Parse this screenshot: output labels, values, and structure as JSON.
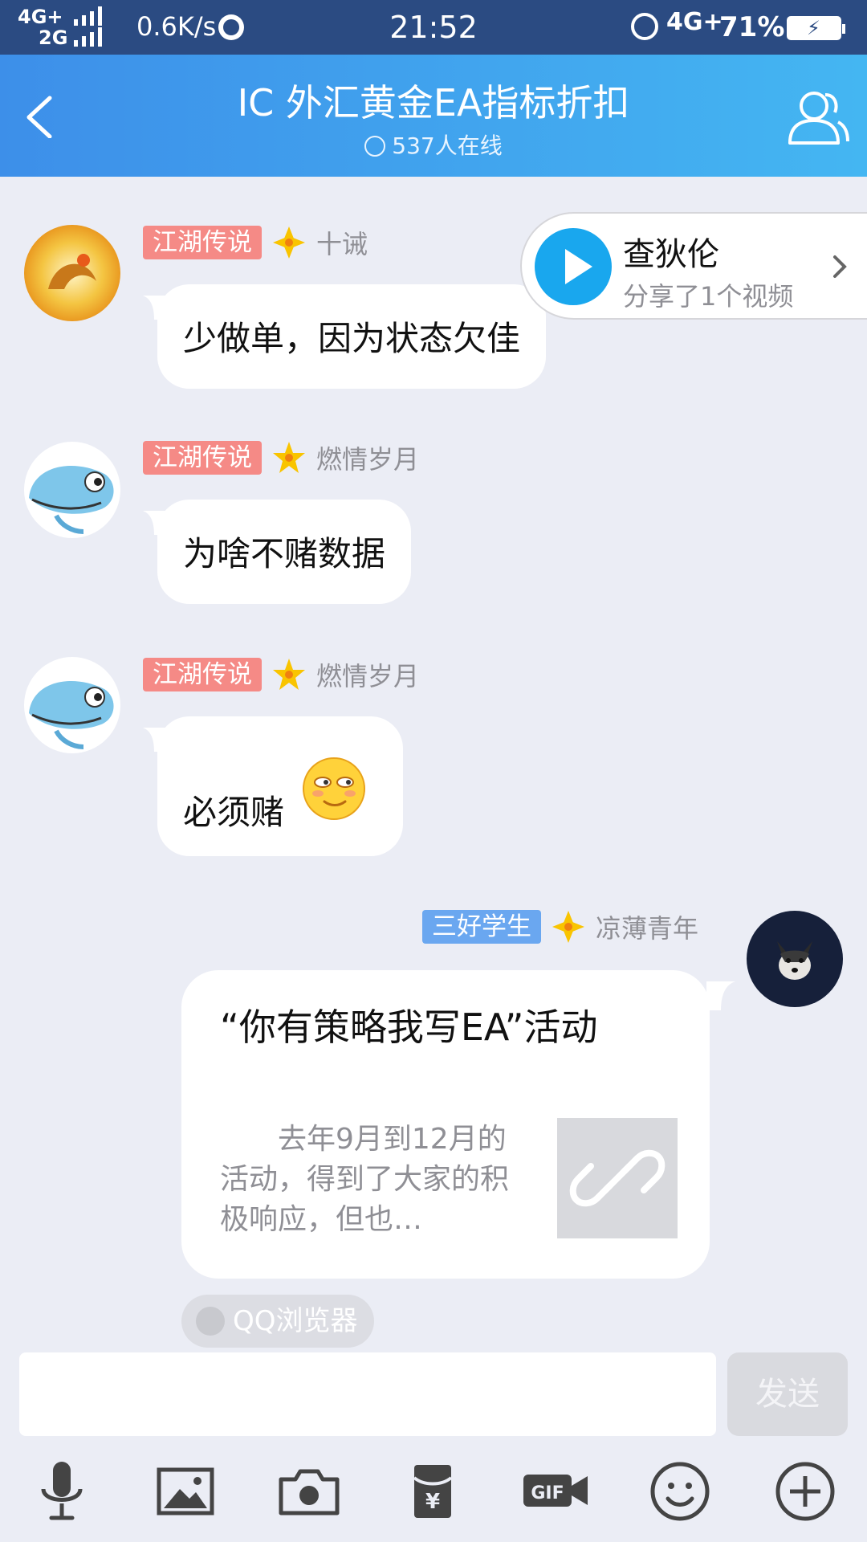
{
  "status_bar": {
    "net_top": "4G+",
    "net_bottom": "2G",
    "speed": "0.6K/s",
    "time": "21:52",
    "net_right": "4G+",
    "battery": "71%"
  },
  "header": {
    "title": "IC 外汇黄金EA指标折扣",
    "online": "537人在线",
    "icons": [
      "back-icon",
      "members-icon"
    ]
  },
  "share": {
    "name": "查狄伦",
    "subtitle": "分享了1个视频"
  },
  "messages": [
    {
      "badge": "江湖传说",
      "nick": "十诫",
      "text": "少做单，因为状态欠佳"
    },
    {
      "badge": "江湖传说",
      "nick": "燃情岁月",
      "text": "为啥不赌数据"
    },
    {
      "badge": "江湖传说",
      "nick": "燃情岁月",
      "text": "必须赌"
    },
    {
      "badge": "三好学生",
      "nick": "凉薄青年"
    }
  ],
  "card": {
    "title": "“你有策略我写EA”活动",
    "desc": "去年9月到12月的活动，得到了大家的积极响应，但也…",
    "source": "QQ浏览器"
  },
  "input": {
    "value": "",
    "send_label": "发送"
  },
  "toolbar": [
    "microphone-icon",
    "image-icon",
    "camera-icon",
    "red-packet-icon",
    "gif-icon",
    "emoji-icon",
    "plus-icon"
  ],
  "colors": {
    "header_start": "#3d8fe9",
    "header_end": "#44b6f2",
    "badge_red": "#f58a86",
    "badge_blue": "#6aa7f0",
    "play_blue": "#19a7ee",
    "background": "#ebedf5"
  }
}
